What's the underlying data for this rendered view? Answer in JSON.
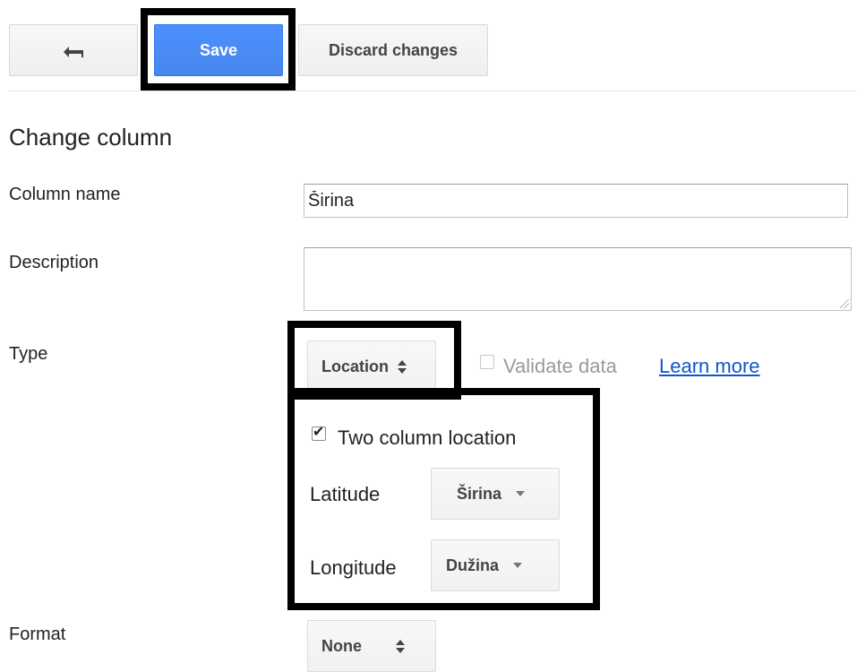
{
  "toolbar": {
    "back_label": "←",
    "save_label": "Save",
    "discard_label": "Discard changes"
  },
  "form": {
    "heading": "Change column",
    "column_name": {
      "label": "Column name",
      "value": "Širina"
    },
    "description": {
      "label": "Description",
      "value": ""
    },
    "type": {
      "label": "Type",
      "selected": "Location",
      "validate_label": "Validate data",
      "validate_checked": false,
      "learn_more": "Learn more"
    },
    "location": {
      "two_column_label": "Two column location",
      "two_column_checked": true,
      "latitude_label": "Latitude",
      "latitude_value": "Širina",
      "longitude_label": "Longitude",
      "longitude_value": "Dužina"
    },
    "format": {
      "label": "Format",
      "selected": "None"
    }
  },
  "colors": {
    "primary": "#4d90fe",
    "link": "#1155cc",
    "highlight": "#000000"
  }
}
